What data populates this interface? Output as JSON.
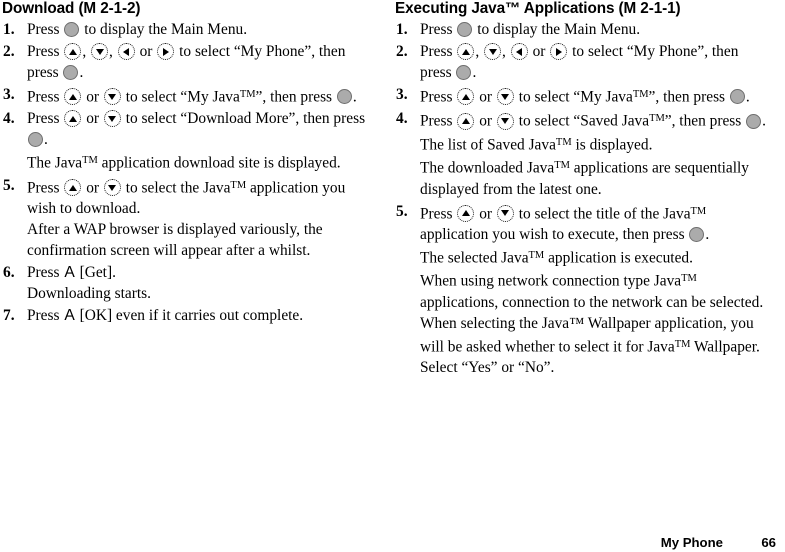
{
  "document": {
    "type": "mobile-phone-user-manual-page",
    "footer": {
      "chapter": "My Phone",
      "page_number": "66"
    }
  },
  "icons": {
    "center_key": "center-select-key-icon",
    "up_key": "navigation-up-key-icon",
    "down_key": "navigation-down-key-icon",
    "left_key": "navigation-left-key-icon",
    "right_key": "navigation-right-key-icon",
    "soft_key_a": "left-soft-key-a-icon"
  },
  "colors": {
    "page_background": "#ffffff",
    "text": "#000000",
    "center_key_fill": "#ababab",
    "center_key_border": "#6e6e6e",
    "direction_key_outline": "#1a1a1a",
    "direction_key_arrow": "#000000"
  },
  "columns": [
    {
      "id": "download",
      "heading": {
        "title": "Download",
        "menu_ref": "(M 2-1-2)"
      },
      "steps": [
        {
          "num": "1.",
          "parts": [
            {
              "t": "text",
              "v": "Press "
            },
            {
              "t": "key",
              "v": "center"
            },
            {
              "t": "text",
              "v": " to display the Main Menu."
            }
          ]
        },
        {
          "num": "2.",
          "parts": [
            {
              "t": "text",
              "v": "Press "
            },
            {
              "t": "key",
              "v": "up"
            },
            {
              "t": "text",
              "v": ", "
            },
            {
              "t": "key",
              "v": "down"
            },
            {
              "t": "text",
              "v": ", "
            },
            {
              "t": "key",
              "v": "left"
            },
            {
              "t": "text",
              "v": " or "
            },
            {
              "t": "key",
              "v": "right"
            },
            {
              "t": "text",
              "v": " to select “My Phone”, then press "
            },
            {
              "t": "key",
              "v": "center"
            },
            {
              "t": "text",
              "v": "."
            }
          ]
        },
        {
          "num": "3.",
          "parts": [
            {
              "t": "text",
              "v": "Press "
            },
            {
              "t": "key",
              "v": "up"
            },
            {
              "t": "text",
              "v": " or "
            },
            {
              "t": "key",
              "v": "down"
            },
            {
              "t": "text",
              "v": " to select “My Java"
            },
            {
              "t": "tm",
              "v": "TM"
            },
            {
              "t": "text",
              "v": "”, then press "
            },
            {
              "t": "key",
              "v": "center"
            },
            {
              "t": "text",
              "v": "."
            }
          ]
        },
        {
          "num": "4.",
          "parts": [
            {
              "t": "text",
              "v": "Press "
            },
            {
              "t": "key",
              "v": "up"
            },
            {
              "t": "text",
              "v": " or "
            },
            {
              "t": "key",
              "v": "down"
            },
            {
              "t": "text",
              "v": " to select “Download More”, then press "
            },
            {
              "t": "key",
              "v": "center"
            },
            {
              "t": "text",
              "v": "."
            }
          ],
          "notes": [
            [
              {
                "t": "text",
                "v": "The Java"
              },
              {
                "t": "tm",
                "v": "TM"
              },
              {
                "t": "text",
                "v": " application download site is displayed."
              }
            ]
          ]
        },
        {
          "num": "5.",
          "parts": [
            {
              "t": "text",
              "v": "Press "
            },
            {
              "t": "key",
              "v": "up"
            },
            {
              "t": "text",
              "v": " or "
            },
            {
              "t": "key",
              "v": "down"
            },
            {
              "t": "text",
              "v": " to select the Java"
            },
            {
              "t": "tm",
              "v": "TM"
            },
            {
              "t": "text",
              "v": " application you wish to download."
            }
          ],
          "notes": [
            [
              {
                "t": "text",
                "v": "After a WAP browser is displayed variously, the confirmation screen will appear after a whilst."
              }
            ]
          ]
        },
        {
          "num": "6.",
          "parts": [
            {
              "t": "text",
              "v": "Press "
            },
            {
              "t": "key",
              "v": "softA"
            },
            {
              "t": "text",
              "v": " [Get]."
            }
          ],
          "notes": [
            [
              {
                "t": "text",
                "v": "Downloading starts."
              }
            ]
          ]
        },
        {
          "num": "7.",
          "parts": [
            {
              "t": "text",
              "v": "Press "
            },
            {
              "t": "key",
              "v": "softA"
            },
            {
              "t": "text",
              "v": " [OK] even if it carries out complete."
            }
          ]
        }
      ]
    },
    {
      "id": "executing-java-applications",
      "heading": {
        "title": "Executing Java™ Applications",
        "menu_ref": "(M 2-1-1)"
      },
      "steps": [
        {
          "num": "1.",
          "parts": [
            {
              "t": "text",
              "v": "Press "
            },
            {
              "t": "key",
              "v": "center"
            },
            {
              "t": "text",
              "v": " to display the Main Menu."
            }
          ]
        },
        {
          "num": "2.",
          "parts": [
            {
              "t": "text",
              "v": "Press "
            },
            {
              "t": "key",
              "v": "up"
            },
            {
              "t": "text",
              "v": ", "
            },
            {
              "t": "key",
              "v": "down"
            },
            {
              "t": "text",
              "v": ", "
            },
            {
              "t": "key",
              "v": "left"
            },
            {
              "t": "text",
              "v": " or "
            },
            {
              "t": "key",
              "v": "right"
            },
            {
              "t": "text",
              "v": " to select “My Phone”, then press "
            },
            {
              "t": "key",
              "v": "center"
            },
            {
              "t": "text",
              "v": "."
            }
          ]
        },
        {
          "num": "3.",
          "parts": [
            {
              "t": "text",
              "v": "Press "
            },
            {
              "t": "key",
              "v": "up"
            },
            {
              "t": "text",
              "v": " or "
            },
            {
              "t": "key",
              "v": "down"
            },
            {
              "t": "text",
              "v": " to select “My Java"
            },
            {
              "t": "tm",
              "v": "TM"
            },
            {
              "t": "text",
              "v": "”, then press "
            },
            {
              "t": "key",
              "v": "center"
            },
            {
              "t": "text",
              "v": "."
            }
          ]
        },
        {
          "num": "4.",
          "parts": [
            {
              "t": "text",
              "v": "Press "
            },
            {
              "t": "key",
              "v": "up"
            },
            {
              "t": "text",
              "v": " or "
            },
            {
              "t": "key",
              "v": "down"
            },
            {
              "t": "text",
              "v": " to select “Saved Java"
            },
            {
              "t": "tm",
              "v": "TM"
            },
            {
              "t": "text",
              "v": "”, then press "
            },
            {
              "t": "key",
              "v": "center"
            },
            {
              "t": "text",
              "v": "."
            }
          ],
          "notes": [
            [
              {
                "t": "text",
                "v": "The list of Saved Java"
              },
              {
                "t": "tm",
                "v": "TM"
              },
              {
                "t": "text",
                "v": " is displayed."
              },
              {
                "t": "br",
                "v": ""
              },
              {
                "t": "text",
                "v": "The downloaded Java"
              },
              {
                "t": "tm",
                "v": "TM"
              },
              {
                "t": "text",
                "v": " applications are sequentially displayed from the latest one."
              }
            ]
          ]
        },
        {
          "num": "5.",
          "parts": [
            {
              "t": "text",
              "v": "Press "
            },
            {
              "t": "key",
              "v": "up"
            },
            {
              "t": "text",
              "v": " or "
            },
            {
              "t": "key",
              "v": "down"
            },
            {
              "t": "text",
              "v": " to select the title of the Java"
            },
            {
              "t": "tm",
              "v": "TM"
            },
            {
              "t": "text",
              "v": " application you wish to execute, then press "
            },
            {
              "t": "key",
              "v": "center"
            },
            {
              "t": "text",
              "v": "."
            }
          ],
          "notes": [
            [
              {
                "t": "text",
                "v": "The selected Java"
              },
              {
                "t": "tm",
                "v": "TM"
              },
              {
                "t": "text",
                "v": " application is executed."
              },
              {
                "t": "br",
                "v": ""
              },
              {
                "t": "text",
                "v": "When using network connection type Java"
              },
              {
                "t": "tm",
                "v": "TM"
              },
              {
                "t": "text",
                "v": " applications, connection to the network can be selected."
              },
              {
                "t": "br",
                "v": ""
              },
              {
                "t": "text",
                "v": "When selecting the Java™ Wallpaper application, you will be asked whether to select it for Java"
              },
              {
                "t": "tm",
                "v": "TM"
              },
              {
                "t": "text",
                "v": " Wallpaper. Select “Yes” or “No”."
              }
            ]
          ]
        }
      ]
    }
  ]
}
